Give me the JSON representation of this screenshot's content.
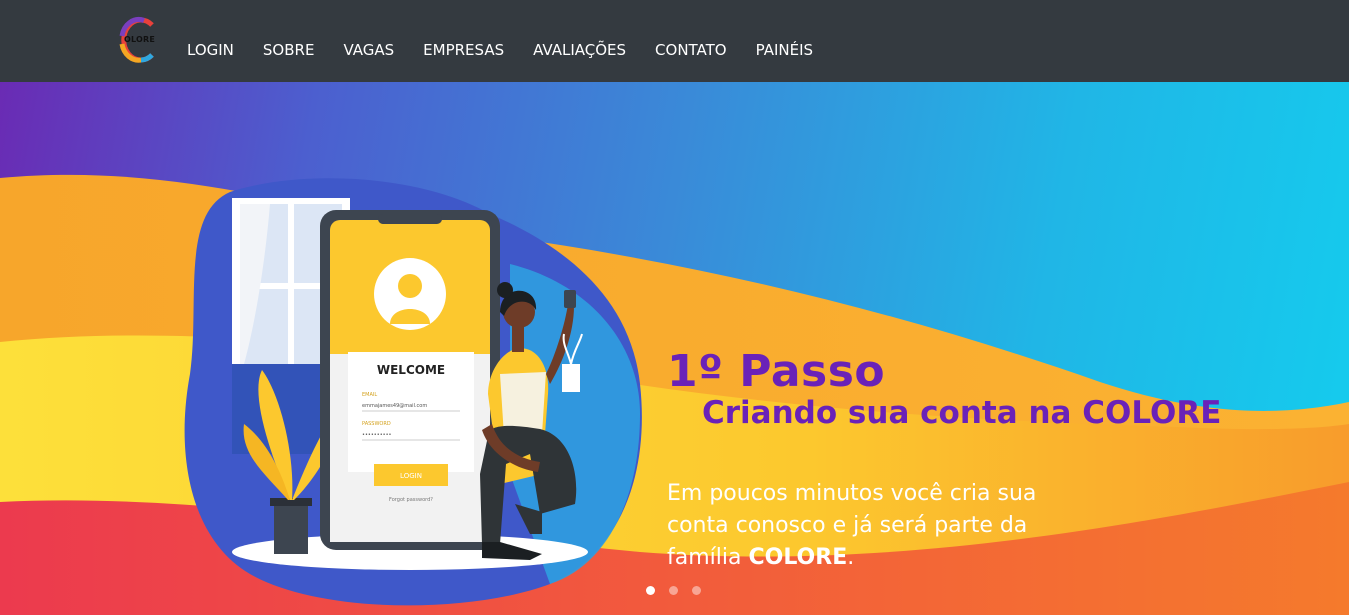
{
  "brand": {
    "logo_text": "OLORE",
    "logo_colors": [
      "#e8413b",
      "#f5a623",
      "#2ea8e0",
      "#7b3fbf"
    ]
  },
  "nav": {
    "items": [
      {
        "label": "LOGIN"
      },
      {
        "label": "SOBRE"
      },
      {
        "label": "VAGAS"
      },
      {
        "label": "EMPRESAS"
      },
      {
        "label": "AVALIAÇÕES"
      },
      {
        "label": "CONTATO"
      },
      {
        "label": "PAINÉIS"
      }
    ]
  },
  "hero": {
    "step_title": "1º Passo",
    "subtitle_prefix": "Criando sua conta na ",
    "subtitle_brand": "COLORE",
    "description_prefix": "Em poucos minutos você cria sua conta conosco e já será parte da família ",
    "description_brand": "COLORE",
    "description_suffix": ".",
    "carousel": {
      "total": 3,
      "active": 1
    }
  },
  "phone_mockup": {
    "welcome": "WELCOME",
    "email_label": "EMAIL",
    "email_value": "emmajames49@mail.com",
    "password_label": "PASSWORD",
    "password_value": "••••••••••",
    "login_button": "LOGIN",
    "forgot": "Forgot password?"
  },
  "colors": {
    "navbar": "#343a40",
    "title_purple": "#6a22b8",
    "accent_yellow": "#fccc2e"
  }
}
